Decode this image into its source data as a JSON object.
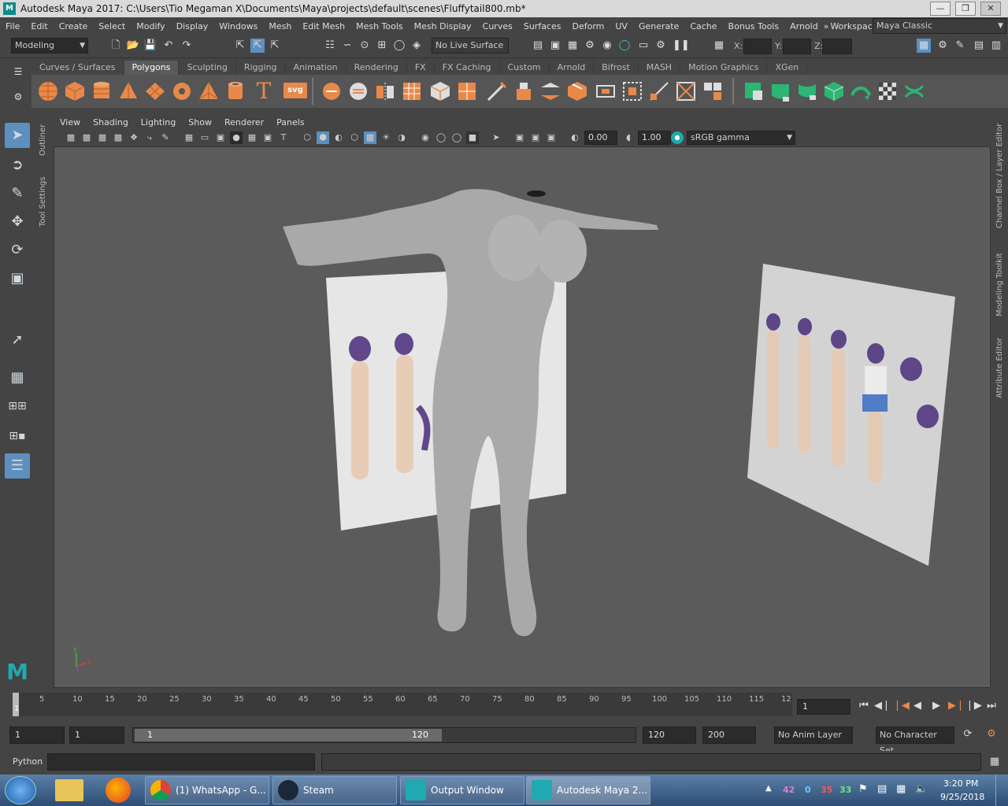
{
  "window": {
    "title": "Autodesk Maya 2017: C:\\Users\\Tio Megaman X\\Documents\\Maya\\projects\\default\\scenes\\Fluffytail800.mb*",
    "logo": "M"
  },
  "menu": [
    "File",
    "Edit",
    "Create",
    "Select",
    "Modify",
    "Display",
    "Windows",
    "Mesh",
    "Edit Mesh",
    "Mesh Tools",
    "Mesh Display",
    "Curves",
    "Surfaces",
    "Deform",
    "UV",
    "Generate",
    "Cache",
    "Bonus Tools",
    "Arnold"
  ],
  "workspace": {
    "label": "Workspace :",
    "value": "Maya Classic",
    "more": "»"
  },
  "statusline": {
    "menuset": "Modeling",
    "live_surface": "No Live Surface",
    "x_label": "X:",
    "y_label": "Y:",
    "z_label": "Z:"
  },
  "shelf_tabs": [
    "Curves / Surfaces",
    "Polygons",
    "Sculpting",
    "Rigging",
    "Animation",
    "Rendering",
    "FX",
    "FX Caching",
    "Custom",
    "Arnold",
    "Bifrost",
    "MASH",
    "Motion Graphics",
    "XGen"
  ],
  "shelf_active": "Polygons",
  "shelf_text_icons": {
    "text": "T",
    "svg": "svg"
  },
  "side_labels": {
    "outliner": "Outliner",
    "tool_settings": "Tool Settings"
  },
  "right_labels": {
    "channel_box": "Channel Box / Layer Editor",
    "modeling_toolkit": "Modeling Toolkit",
    "attribute_editor": "Attribute Editor"
  },
  "panel_menu": [
    "View",
    "Shading",
    "Lighting",
    "Show",
    "Renderer",
    "Panels"
  ],
  "panel_toolbar": {
    "exposure": "0.00",
    "gamma": "1.00",
    "colorspace": "sRGB gamma"
  },
  "viewport": {
    "axis_x": "x",
    "axis_y": "y"
  },
  "timeline": {
    "ticks": [
      "5",
      "10",
      "15",
      "20",
      "25",
      "30",
      "35",
      "40",
      "45",
      "50",
      "55",
      "60",
      "65",
      "70",
      "75",
      "80",
      "85",
      "90",
      "95",
      "100",
      "105",
      "110",
      "115",
      "12"
    ],
    "start_marker": "1",
    "current_frame": "1"
  },
  "range": {
    "start": "1",
    "playback_start": "1",
    "slider_start": "1",
    "slider_end": "120",
    "playback_end": "120",
    "end": "200",
    "anim_layer": "No Anim Layer",
    "character_set": "No Character Set"
  },
  "cmdline": {
    "lang": "Python"
  },
  "taskbar": {
    "items": [
      "(1) WhatsApp - G...",
      "Steam",
      "Output Window",
      "Autodesk Maya 2..."
    ],
    "tray_numbers": [
      "42",
      "0",
      "35",
      "33"
    ],
    "time": "3:20 PM",
    "date": "9/25/2018"
  },
  "colors": {
    "accent_orange": "#e8894a",
    "shelf_green": "#2bb673",
    "maya_teal": "#20a9b0",
    "viewport_bg": "#5b5b5b"
  }
}
